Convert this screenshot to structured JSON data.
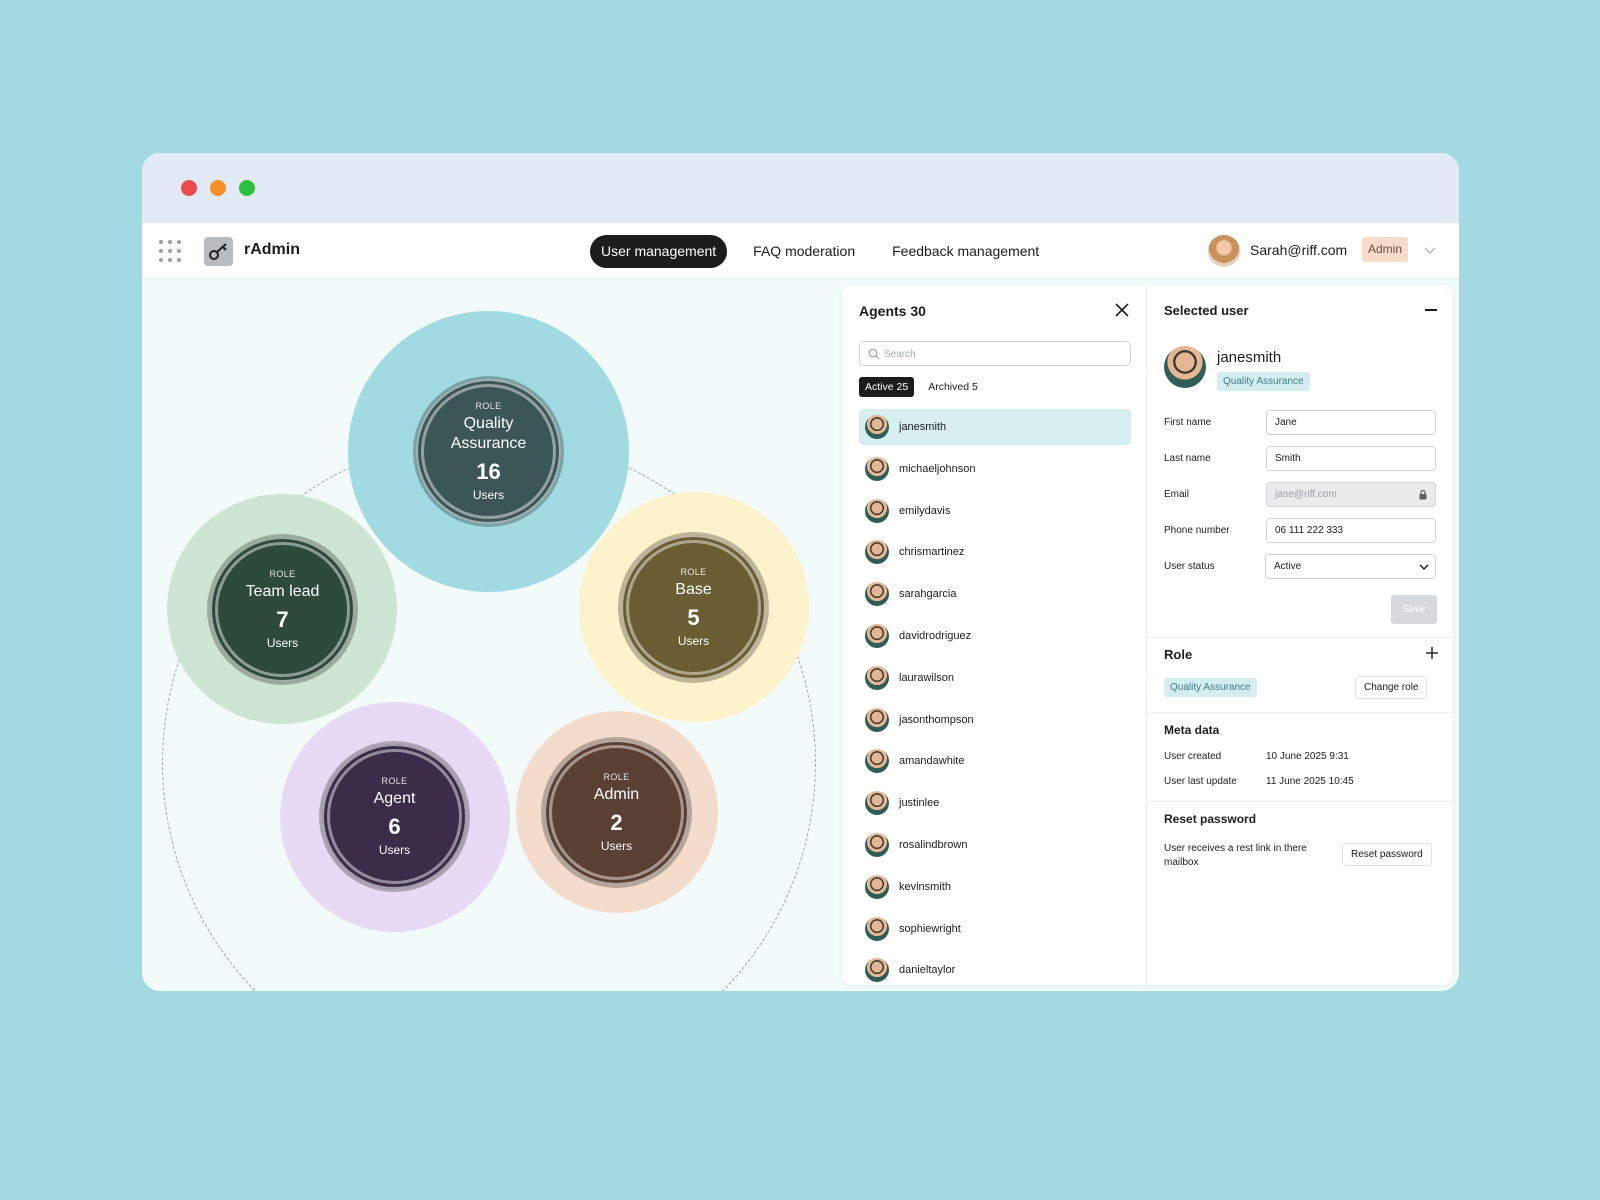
{
  "app": {
    "name": "rAdmin"
  },
  "nav": {
    "tabs": [
      {
        "label": "User management",
        "active": true
      },
      {
        "label": "FAQ moderation",
        "active": false
      },
      {
        "label": "Feedback management",
        "active": false
      }
    ]
  },
  "account": {
    "email": "Sarah@riff.com",
    "role": "Admin"
  },
  "roles": [
    {
      "label": "ROLE",
      "name": "Quality Assurance",
      "count": "16",
      "unit": "Users",
      "outer_color": "#a1dae0",
      "core_color": "#3c5556"
    },
    {
      "label": "ROLE",
      "name": "Team lead",
      "count": "7",
      "unit": "Users",
      "outer_color": "#cfe5d3",
      "core_color": "#2e4a3b"
    },
    {
      "label": "ROLE",
      "name": "Base",
      "count": "5",
      "unit": "Users",
      "outer_color": "#fcf2cc",
      "core_color": "#6a5d34"
    },
    {
      "label": "ROLE",
      "name": "Agent",
      "count": "6",
      "unit": "Users",
      "outer_color": "#e7daf5",
      "core_color": "#3b2c4a"
    },
    {
      "label": "ROLE",
      "name": "Admin",
      "count": "2",
      "unit": "Users",
      "outer_color": "#f3dccb",
      "core_color": "#5a4033"
    }
  ],
  "agents": {
    "title": "Agents 30",
    "search_placeholder": "Search",
    "filters": [
      {
        "label": "Active 25",
        "active": true
      },
      {
        "label": "Archived 5",
        "active": false
      }
    ],
    "users": [
      "janesmith",
      "michaeljohnson",
      "emilydavis",
      "chrismartinez",
      "sarahgarcia",
      "davidrodriguez",
      "laurawilson",
      "jasonthompson",
      "amandawhite",
      "justinlee",
      "rosalindbrown",
      "kevinsmith",
      "sophiewright",
      "danieltaylor"
    ],
    "selected_index": 0
  },
  "selected_user": {
    "title": "Selected user",
    "username": "janesmith",
    "role_tag": "Quality Assurance",
    "fields": {
      "first_name_label": "First name",
      "first_name": "Jane",
      "last_name_label": "Last name",
      "last_name": "Smith",
      "email_label": "Email",
      "email": "jane@riff.com",
      "phone_label": "Phone number",
      "phone": "06 111 222 333",
      "status_label": "User status",
      "status": "Active"
    },
    "save_label": "Save",
    "role_section": {
      "title": "Role",
      "role": "Quality Assurance",
      "change_label": "Change role"
    },
    "meta": {
      "title": "Meta data",
      "created_label": "User created",
      "created": "10 June 2025  9:31",
      "updated_label": "User last update",
      "updated": "11 June 2025  10:45"
    },
    "reset": {
      "title": "Reset password",
      "text": "User receives a rest link in there mailbox",
      "button": "Reset password"
    }
  }
}
